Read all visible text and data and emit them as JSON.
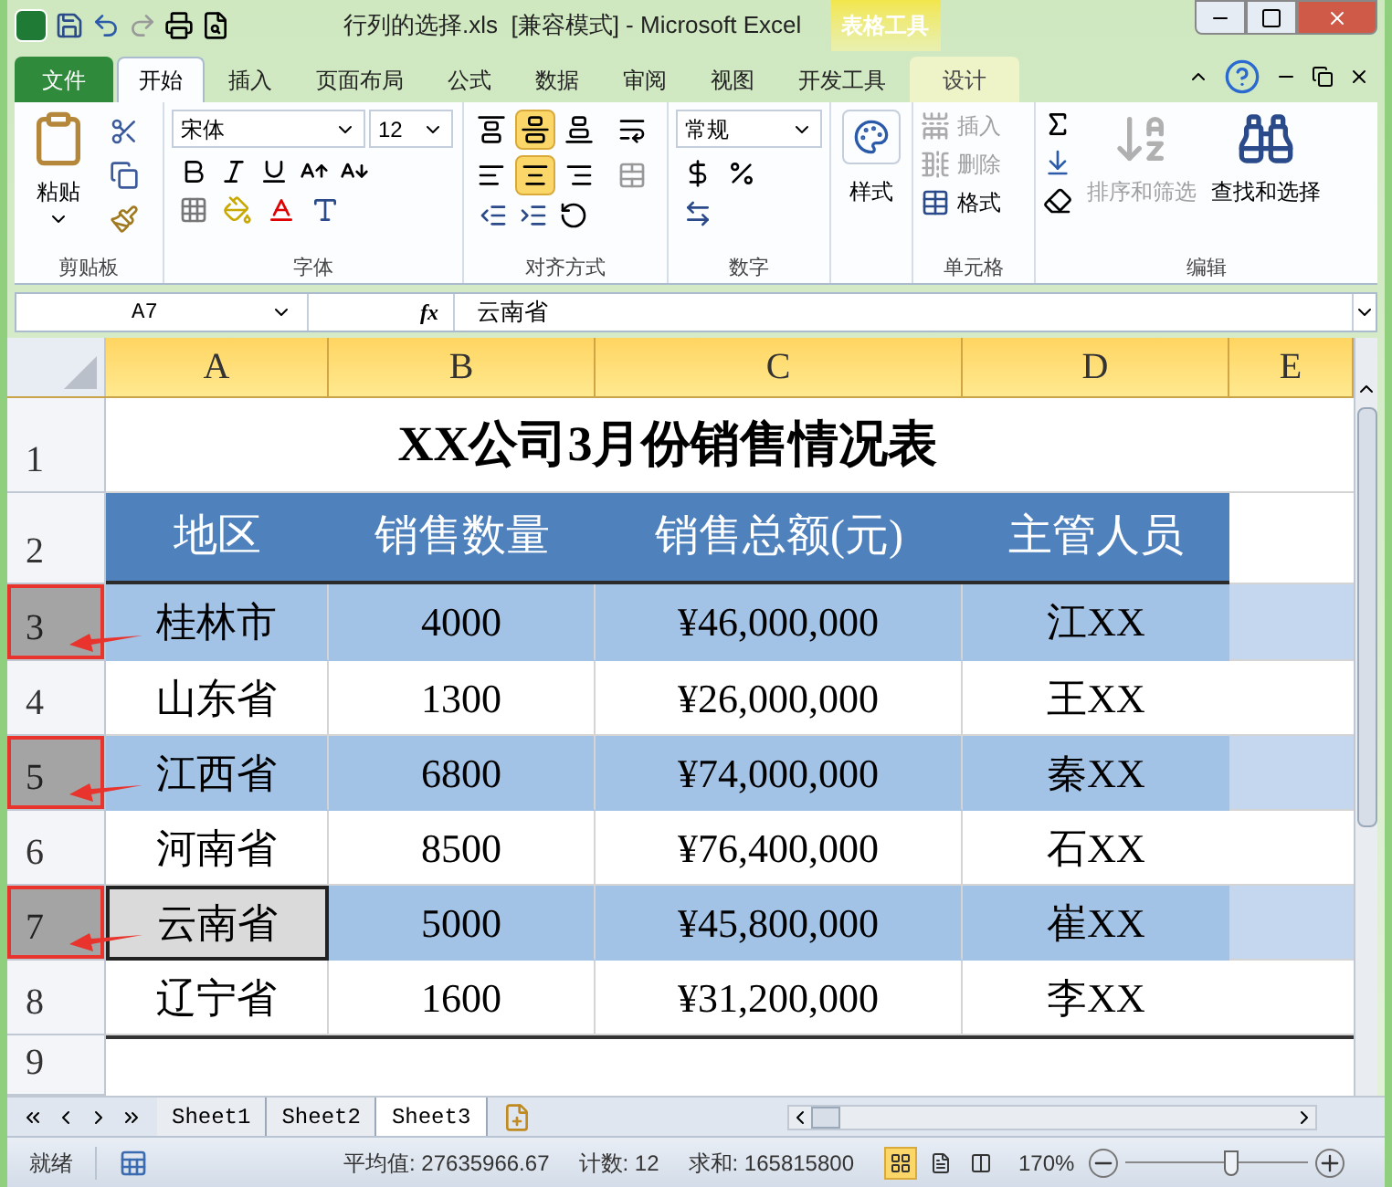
{
  "window": {
    "title": "行列的选择.xls  [兼容模式] - Microsoft Excel",
    "contextual_group": "表格工具"
  },
  "ribbon_tabs": [
    {
      "label": "文件",
      "kind": "file",
      "selected": false
    },
    {
      "label": "开始",
      "kind": "normal",
      "selected": true
    },
    {
      "label": "插入",
      "kind": "normal",
      "selected": false
    },
    {
      "label": "页面布局",
      "kind": "normal",
      "selected": false
    },
    {
      "label": "公式",
      "kind": "normal",
      "selected": false
    },
    {
      "label": "数据",
      "kind": "normal",
      "selected": false
    },
    {
      "label": "审阅",
      "kind": "normal",
      "selected": false
    },
    {
      "label": "视图",
      "kind": "normal",
      "selected": false
    },
    {
      "label": "开发工具",
      "kind": "normal",
      "selected": false
    },
    {
      "label": "设计",
      "kind": "contextual",
      "selected": false
    }
  ],
  "ribbon": {
    "clipboard": {
      "label": "剪贴板",
      "paste": "粘贴"
    },
    "font": {
      "label": "字体",
      "name": "宋体",
      "size": "12"
    },
    "alignment": {
      "label": "对齐方式",
      "vertical": [
        {
          "selected": false
        },
        {
          "selected": true
        },
        {
          "selected": false
        }
      ],
      "horizontal": [
        {
          "selected": false
        },
        {
          "selected": true
        },
        {
          "selected": false
        }
      ]
    },
    "number": {
      "label": "数字",
      "format": "常规"
    },
    "styles": {
      "label": "样式"
    },
    "cells": {
      "label": "单元格",
      "items": [
        {
          "label": "插入",
          "disabled": true
        },
        {
          "label": "删除",
          "disabled": true
        },
        {
          "label": "格式",
          "disabled": false
        }
      ]
    },
    "editing": {
      "label": "编辑",
      "sort_filter": {
        "label": "排序和筛选",
        "disabled": true
      },
      "find": {
        "label": "查找和选择",
        "disabled": false
      }
    }
  },
  "formula_bar": {
    "name_box": "A7",
    "function_label": "fx",
    "value": "云南省"
  },
  "sheet": {
    "columns": [
      {
        "label": "A"
      },
      {
        "label": "B"
      },
      {
        "label": "C"
      },
      {
        "label": "D"
      },
      {
        "label": "E"
      }
    ],
    "rows": [
      {
        "number": "1",
        "kind": "title",
        "selected": false,
        "annotated": false,
        "title": "XX公司3月份销售情况表"
      },
      {
        "number": "2",
        "kind": "header",
        "selected": false,
        "annotated": false,
        "cells": [
          "地区",
          "销售数量",
          "销售总额(元)",
          "主管人员"
        ]
      },
      {
        "number": "3",
        "kind": "data",
        "banded": true,
        "selected": true,
        "annotated": true,
        "cells": [
          {
            "text": "桂林市",
            "active": false
          },
          {
            "text": "4000",
            "active": false
          },
          {
            "text": "¥46,000,000",
            "active": false
          },
          {
            "text": "江XX",
            "active": false
          }
        ]
      },
      {
        "number": "4",
        "kind": "data",
        "banded": false,
        "selected": false,
        "annotated": false,
        "cells": [
          {
            "text": "山东省",
            "active": false
          },
          {
            "text": "1300",
            "active": false
          },
          {
            "text": "¥26,000,000",
            "active": false
          },
          {
            "text": "王XX",
            "active": false
          }
        ]
      },
      {
        "number": "5",
        "kind": "data",
        "banded": true,
        "selected": true,
        "annotated": true,
        "cells": [
          {
            "text": "江西省",
            "active": false
          },
          {
            "text": "6800",
            "active": false
          },
          {
            "text": "¥74,000,000",
            "active": false
          },
          {
            "text": "秦XX",
            "active": false
          }
        ]
      },
      {
        "number": "6",
        "kind": "data",
        "banded": false,
        "selected": false,
        "annotated": false,
        "cells": [
          {
            "text": "河南省",
            "active": false
          },
          {
            "text": "8500",
            "active": false
          },
          {
            "text": "¥76,400,000",
            "active": false
          },
          {
            "text": "石XX",
            "active": false
          }
        ]
      },
      {
        "number": "7",
        "kind": "data",
        "banded": true,
        "selected": true,
        "annotated": true,
        "cells": [
          {
            "text": "云南省",
            "active": true
          },
          {
            "text": "5000",
            "active": false
          },
          {
            "text": "¥45,800,000",
            "active": false
          },
          {
            "text": "崔XX",
            "active": false
          }
        ]
      },
      {
        "number": "8",
        "kind": "data",
        "banded": false,
        "selected": false,
        "annotated": false,
        "cells": [
          {
            "text": "辽宁省",
            "active": false
          },
          {
            "text": "1600",
            "active": false
          },
          {
            "text": "¥31,200,000",
            "active": false
          },
          {
            "text": "李XX",
            "active": false
          }
        ]
      },
      {
        "number": "9",
        "kind": "empty",
        "selected": false,
        "annotated": false,
        "cells": []
      }
    ]
  },
  "sheet_tabs": [
    {
      "label": "Sheet1",
      "selected": false
    },
    {
      "label": "Sheet2",
      "selected": false
    },
    {
      "label": "Sheet3",
      "selected": true
    }
  ],
  "status_bar": {
    "ready": "就绪",
    "average": "平均值: 27635966.67",
    "count": "计数: 12",
    "sum": "求和: 165815800",
    "views": [
      {
        "selected": true
      },
      {
        "selected": false
      },
      {
        "selected": false
      }
    ],
    "zoom": "170%",
    "zoom_slider": {
      "level": 0.58
    }
  }
}
